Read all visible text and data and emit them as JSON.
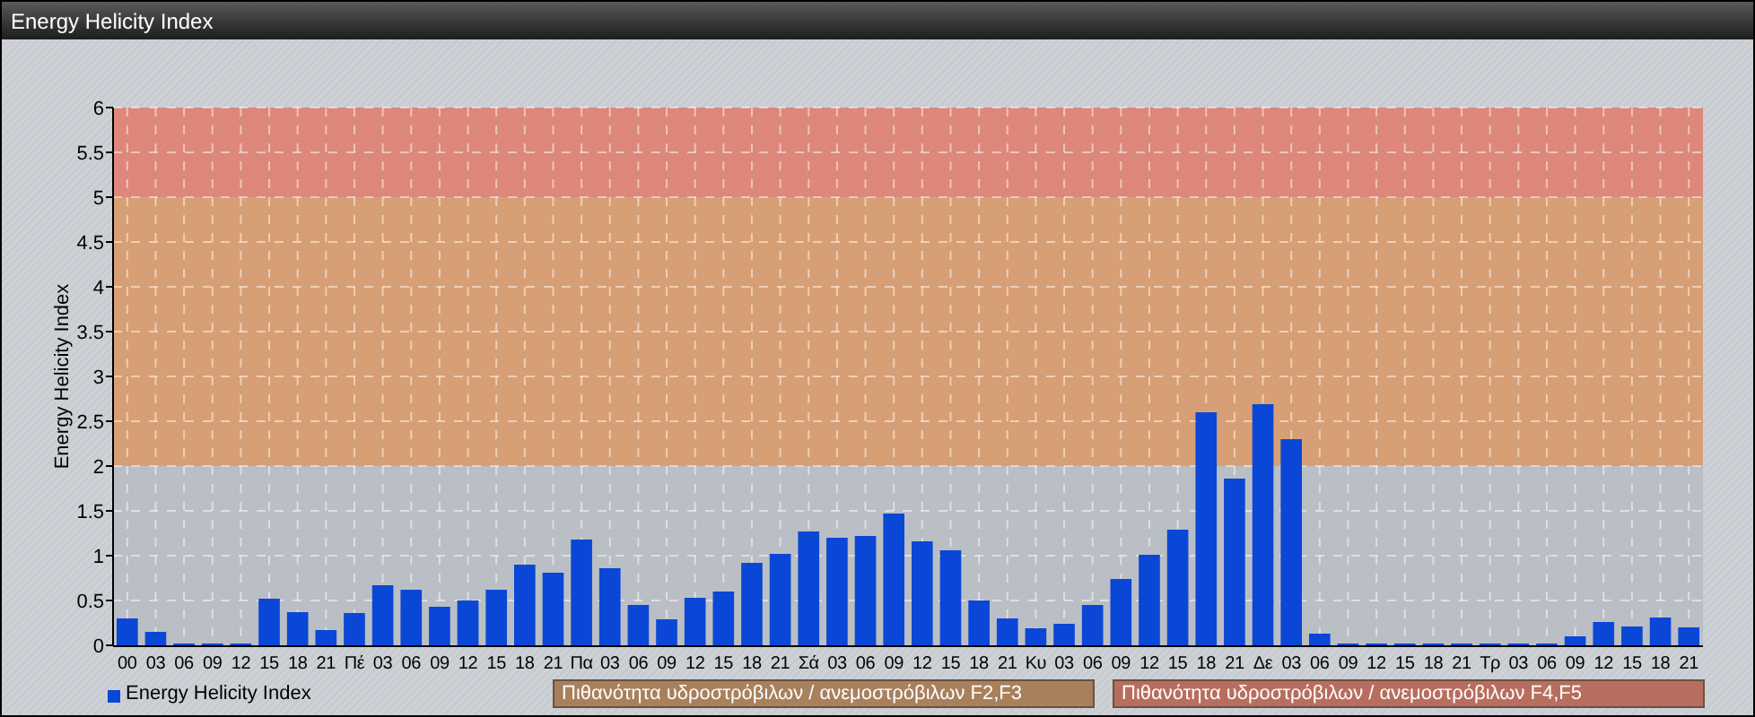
{
  "window": {
    "title": "Energy Helicity Index"
  },
  "chart_data": {
    "type": "bar",
    "ylabel": "Energy Helicity Index",
    "categories": [
      "00",
      "03",
      "06",
      "09",
      "12",
      "15",
      "18",
      "21",
      "Πέ",
      "03",
      "06",
      "09",
      "12",
      "15",
      "18",
      "21",
      "Πα",
      "03",
      "06",
      "09",
      "12",
      "15",
      "18",
      "21",
      "Σά",
      "03",
      "06",
      "09",
      "12",
      "15",
      "18",
      "21",
      "Κυ",
      "03",
      "06",
      "09",
      "12",
      "15",
      "18",
      "21",
      "Δε",
      "03",
      "06",
      "09",
      "12",
      "15",
      "18",
      "21",
      "Τρ",
      "03",
      "06",
      "09",
      "12",
      "15",
      "18",
      "21"
    ],
    "series": [
      {
        "name": "Energy Helicity Index",
        "color": "#0a47d6",
        "values": [
          0.3,
          0.15,
          0.02,
          0.02,
          0.02,
          0.52,
          0.37,
          0.17,
          0.36,
          0.67,
          0.62,
          0.43,
          0.5,
          0.62,
          0.9,
          0.81,
          1.18,
          0.86,
          0.45,
          0.29,
          0.53,
          0.6,
          0.92,
          1.02,
          1.27,
          1.2,
          1.22,
          1.47,
          1.16,
          1.06,
          0.5,
          0.3,
          0.19,
          0.24,
          0.45,
          0.74,
          1.01,
          1.29,
          2.6,
          1.86,
          2.69,
          2.3,
          0.13,
          0.02,
          0.02,
          0.02,
          0.02,
          0.02,
          0.02,
          0.02,
          0.02,
          0.1,
          0.26,
          0.21,
          0.31,
          0.2
        ]
      }
    ],
    "ylim": [
      0,
      6
    ],
    "yticks": [
      0,
      0.5,
      1,
      1.5,
      2,
      2.5,
      3,
      3.5,
      4,
      4.5,
      5,
      5.5,
      6
    ],
    "grid": true,
    "bands": [
      {
        "axis": "y",
        "from": 0,
        "to": 2,
        "color": "#b8bdc3"
      },
      {
        "axis": "y",
        "from": 2,
        "to": 5,
        "color": "#d8996a"
      },
      {
        "axis": "y",
        "from": 5,
        "to": 6,
        "color": "#df8070"
      }
    ]
  },
  "band_legend": [
    {
      "label": "Πιθανότητα υδροστρόβιλων / ανεμοστρόβιλων F2,F3",
      "color": "#a8805c"
    },
    {
      "label": "Πιθανότητα υδροστρόβιλων / ανεμοστρόβιλων F4,F5",
      "color": "#b76e5e"
    }
  ]
}
